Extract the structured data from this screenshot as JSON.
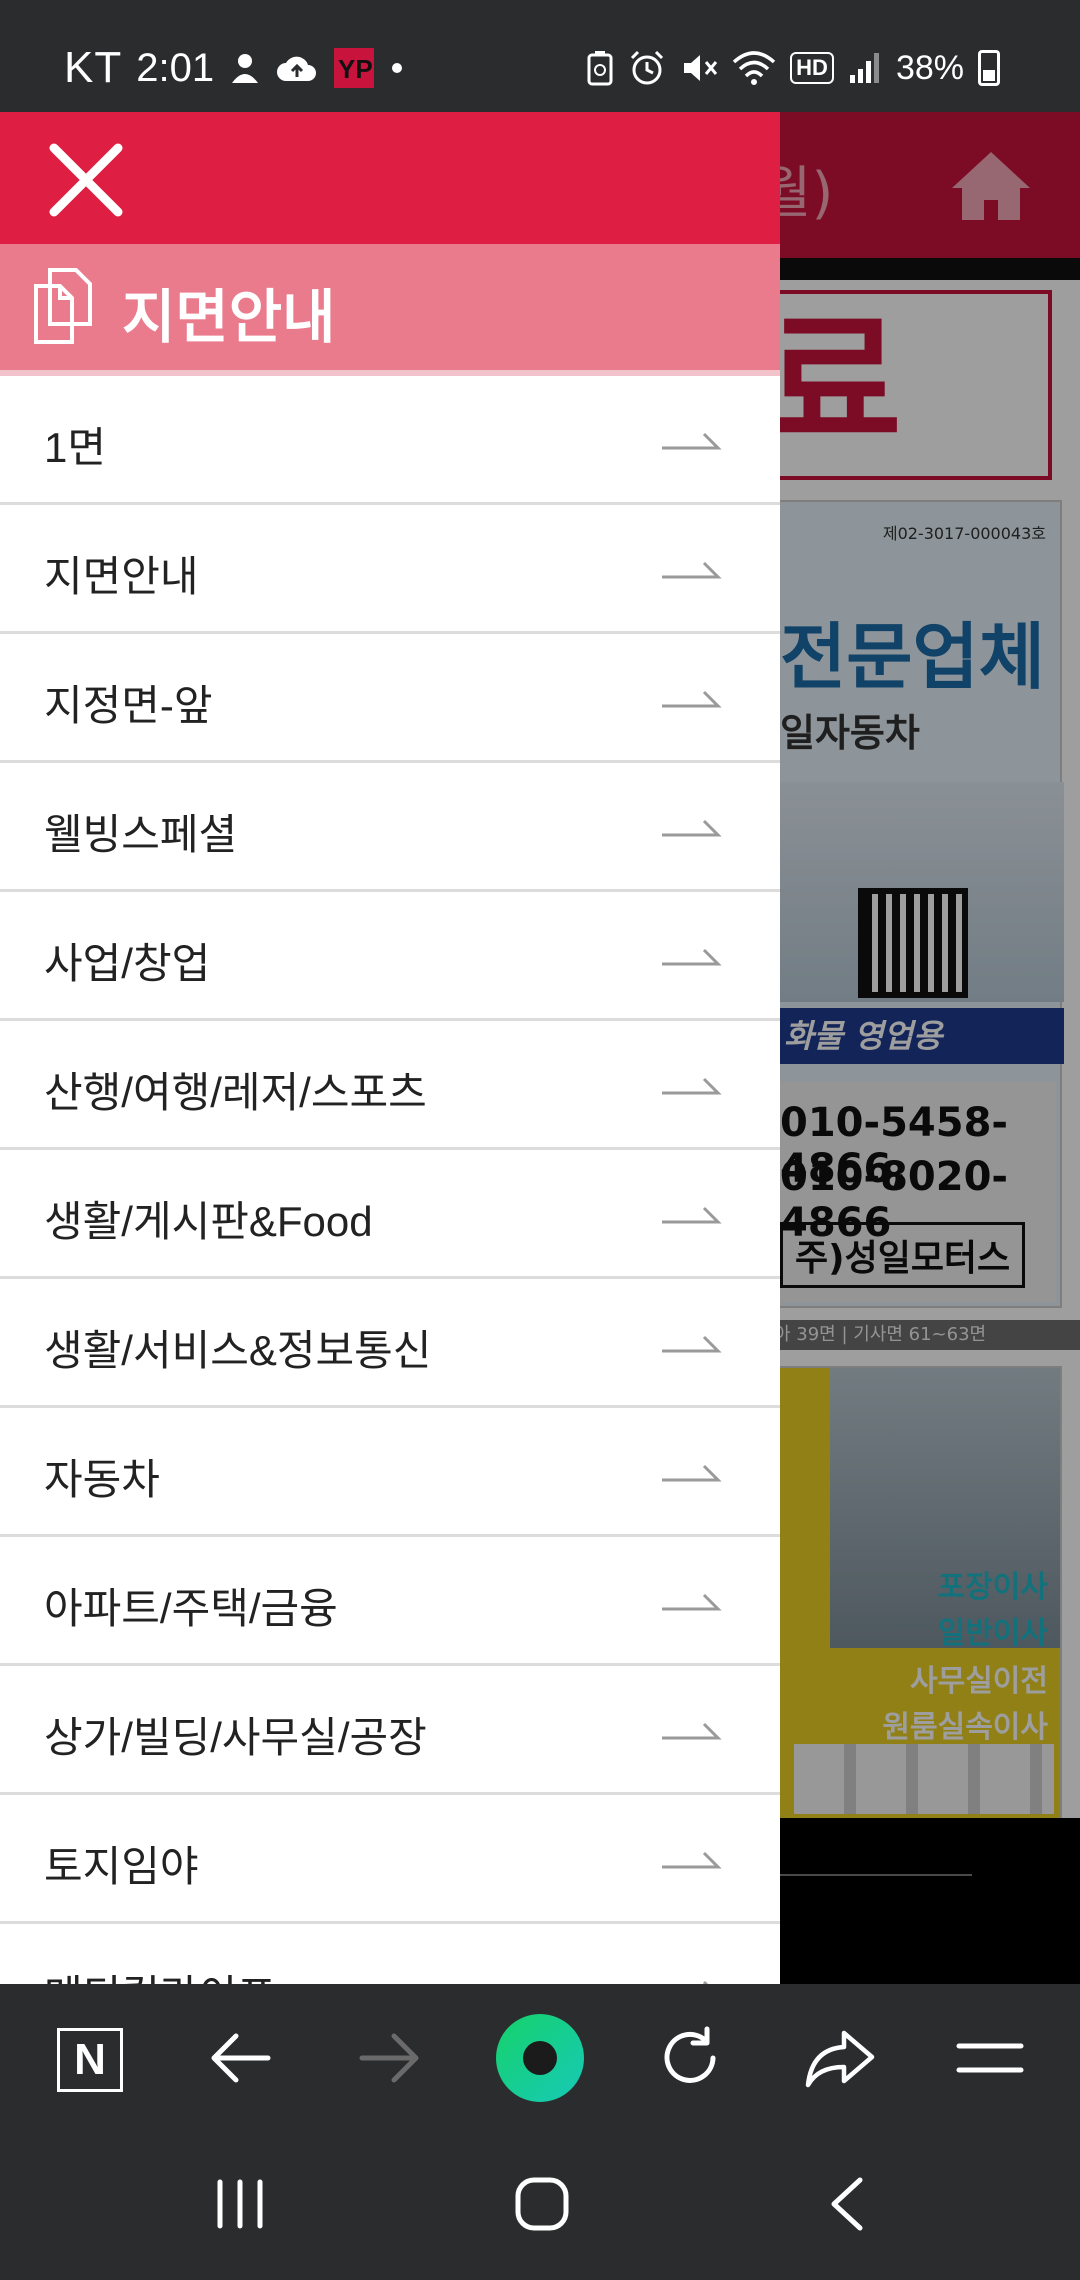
{
  "status_bar": {
    "carrier": "KT",
    "time": "2:01",
    "network_badge": "HD",
    "battery": "38%",
    "icons": [
      "person-icon",
      "cloud-upload-icon",
      "yp-app-icon",
      "dot-icon",
      "recycle-battery-icon",
      "alarm-icon",
      "mute-icon",
      "wifi-icon",
      "hd-icon",
      "signal-icon",
      "battery-icon"
    ]
  },
  "background_page": {
    "header_title_fragment": "월)",
    "home_icon": "home-icon",
    "red_box_text": "자료",
    "ad1": {
      "registration": "제02-3017-000043호",
      "headline": "전문업체",
      "subtitle": "일자동차",
      "band_text": "화물 영업용",
      "phone_1": "010-5458-4866,",
      "phone_2": "010-8020-4866",
      "company": "주)성일모터스"
    },
    "ad_info": "아 39면  |  기사면 61~63면",
    "ad2": {
      "line_1": "포장이사",
      "line_2": "일반이사",
      "line_3": "사무실이전",
      "line_4": "원룸실속이사"
    }
  },
  "drawer": {
    "close_icon": "close-icon",
    "section_title": "지면안내",
    "section_icon": "document-icon",
    "menu_items": [
      {
        "label": "1면"
      },
      {
        "label": "지면안내"
      },
      {
        "label": "지정면-앞"
      },
      {
        "label": "웰빙스페셜"
      },
      {
        "label": "사업/창업"
      },
      {
        "label": "산행/여행/레저/스포츠"
      },
      {
        "label": "생활/게시판&Food"
      },
      {
        "label": "생활/서비스&정보통신"
      },
      {
        "label": "자동차"
      },
      {
        "label": "아파트/주택/금융"
      },
      {
        "label": "상가/빌딩/사무실/공장"
      },
      {
        "label": "토지임야"
      },
      {
        "label": "메디컬라이프"
      }
    ]
  },
  "toolbar": {
    "n_label": "N",
    "buttons": [
      "naver-n-icon",
      "back-arrow-icon",
      "forward-arrow-icon",
      "green-dot-icon",
      "refresh-icon",
      "share-icon",
      "menu-icon"
    ]
  },
  "nav": {
    "buttons": [
      "recent-apps-icon",
      "home-circle-icon",
      "back-chevron-icon"
    ]
  },
  "colors": {
    "drawer_header": "#de1f43",
    "drawer_section": "#ea7b8d",
    "status_bar": "#2b2c2e",
    "green_accent": "#18d27a"
  }
}
